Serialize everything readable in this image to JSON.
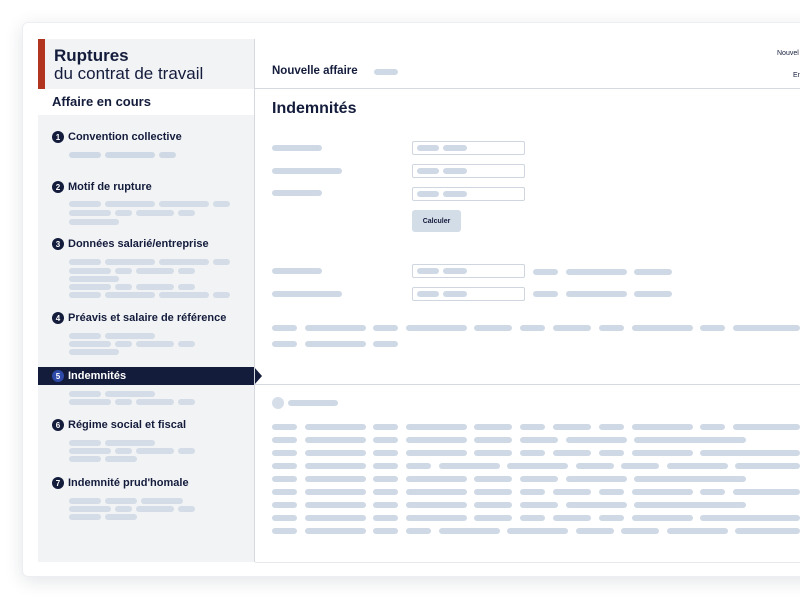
{
  "brand": {
    "title": "Ruptures",
    "subtitle": "du contrat de travail"
  },
  "sidebar": {
    "section_label": "Affaire en cours",
    "steps": [
      {
        "num": "1",
        "label": "Convention collective"
      },
      {
        "num": "2",
        "label": "Motif de rupture"
      },
      {
        "num": "3",
        "label": "Données salarié/entreprise"
      },
      {
        "num": "4",
        "label": "Préavis et salaire de référence"
      },
      {
        "num": "5",
        "label": "Indemnités"
      },
      {
        "num": "6",
        "label": "Régime social et fiscal"
      },
      {
        "num": "7",
        "label": "Indemnité prud'homale"
      }
    ],
    "active_step": "5"
  },
  "header": {
    "title": "Nouvelle affaire",
    "right_top": "Nouvel",
    "right_bottom": "En"
  },
  "main": {
    "title": "Indemnités",
    "calculate_label": "Calculer"
  },
  "colors": {
    "navy": "#141c3c",
    "brand_red": "#b0341e",
    "placeholder": "#cfd9e5"
  }
}
